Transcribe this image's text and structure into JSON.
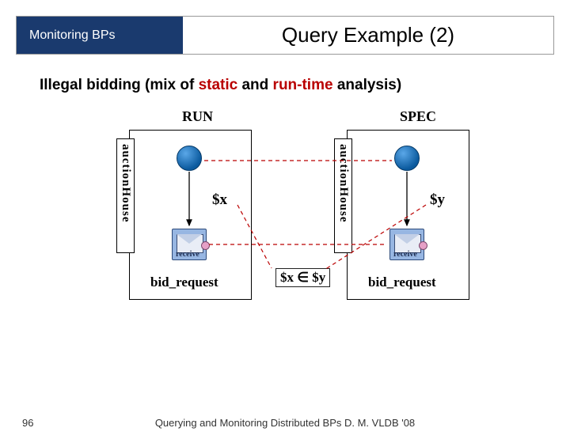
{
  "header": {
    "left": "Monitoring  BPs",
    "title": "Query Example (2)"
  },
  "description": {
    "prefix": "Illegal bidding (mix of  ",
    "static_word": "static",
    "mid": " and ",
    "run_time": "run-time",
    "suffix": " analysis)"
  },
  "diagram": {
    "run": "RUN",
    "spec": "SPEC",
    "auctionHouse": "auctionHouse",
    "var_x": "$x",
    "var_y": "$y",
    "receive": "receive",
    "bid_request": "bid_request",
    "condition": "$x ∈ $y"
  },
  "footer": {
    "slide_num": "96",
    "text": "Querying and Monitoring Distributed BPs D. M. VLDB '08"
  }
}
